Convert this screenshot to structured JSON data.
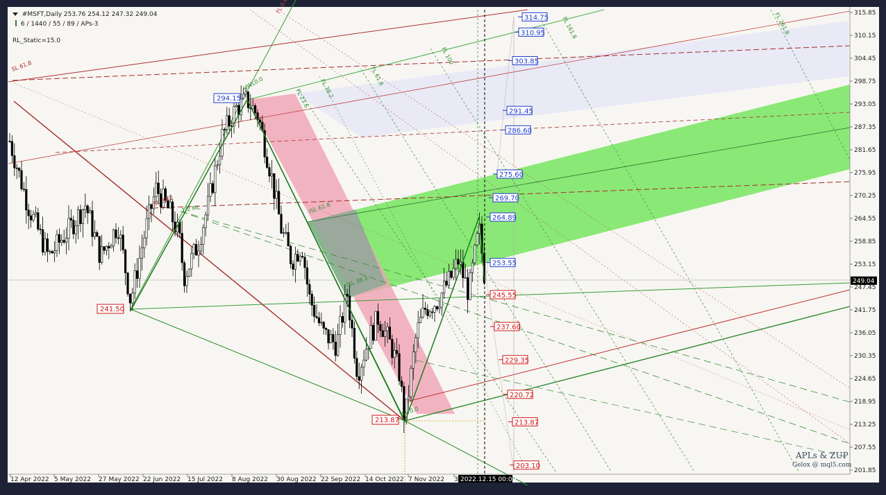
{
  "window": {
    "symbol_line": "#MSFT,Daily  253.76 254.12 247.32 249.04",
    "indicator_line": "6 / 1440 / 55 / 89 / APs-3",
    "static_label": "RL_Static=15.0"
  },
  "watermark": {
    "line1": "APLs & ZUP",
    "line2": "Gelox @ mql5.com"
  },
  "chart_data": {
    "type": "candlestick",
    "symbol": "#MSFT",
    "timeframe": "Daily",
    "ohlc_last": {
      "open": 253.76,
      "high": 254.12,
      "low": 247.32,
      "close": 249.04
    },
    "current_price": 249.04,
    "ylim": [
      201.85,
      315.85
    ],
    "y_ticks": [
      "315.85",
      "310.15",
      "304.45",
      "298.75",
      "293.05",
      "287.35",
      "281.65",
      "275.95",
      "270.25",
      "264.55",
      "258.85",
      "253.15",
      "247.45",
      "241.75",
      "236.05",
      "230.35",
      "224.65",
      "218.95",
      "213.25",
      "207.55",
      "201.85"
    ],
    "x_ticks": [
      "12 Apr 2022",
      "5 May 2022",
      "27 May 2022",
      "22 Jun 2022",
      "15 Jul 2022",
      "8 Aug 2022",
      "30 Aug 2022",
      "22 Sep 2022",
      "14 Oct 2022",
      "7 Nov 2022",
      "3"
    ],
    "cursor_time": "2022.12.15 00:00",
    "zigzag": [
      {
        "label": "241.50",
        "value": 241.5
      },
      {
        "label": "294.15",
        "value": 294.15
      },
      {
        "label": "213.87",
        "value": 213.87
      },
      {
        "label": "264.89",
        "value": 264.89
      }
    ],
    "levels_up": [
      {
        "label": "314.75",
        "value": 314.75
      },
      {
        "label": "310.95",
        "value": 310.95
      },
      {
        "label": "303.85",
        "value": 303.85
      },
      {
        "label": "291.45",
        "value": 291.45
      },
      {
        "label": "286.60",
        "value": 286.6
      },
      {
        "label": "275.60",
        "value": 275.6
      },
      {
        "label": "269.70",
        "value": 269.7
      },
      {
        "label": "264.89",
        "value": 264.89
      },
      {
        "label": "253.55",
        "value": 253.55
      }
    ],
    "levels_down": [
      {
        "label": "245.55",
        "value": 245.55
      },
      {
        "label": "237.60",
        "value": 237.6
      },
      {
        "label": "229.35",
        "value": 229.35
      },
      {
        "label": "220.72",
        "value": 220.72
      },
      {
        "label": "213.87",
        "value": 213.87
      },
      {
        "label": "203.10",
        "value": 203.1
      }
    ],
    "line_labels": [
      "UWL0.0",
      "SL 61.8",
      "SL 38.2",
      "1/2 ML",
      "ISL 61.8",
      "FL 23.6",
      "FL 38.2",
      "FL 61.8",
      "FL 100",
      "FL 161.8",
      "FL 261.8",
      "ISL 38.2",
      "SL 0.0",
      "FL 0.0"
    ],
    "colors": {
      "background": "#f7f6f2",
      "candle": "#000000",
      "green_channel": "#77e660",
      "pink_zone": "#f0a2b4",
      "blue_zone": "#e4e6f7",
      "fib_green": "#2e8b2e",
      "fib_red": "#a52a2a",
      "level_up_label": "#1f3cc8",
      "level_down_label": "#d01818"
    }
  }
}
